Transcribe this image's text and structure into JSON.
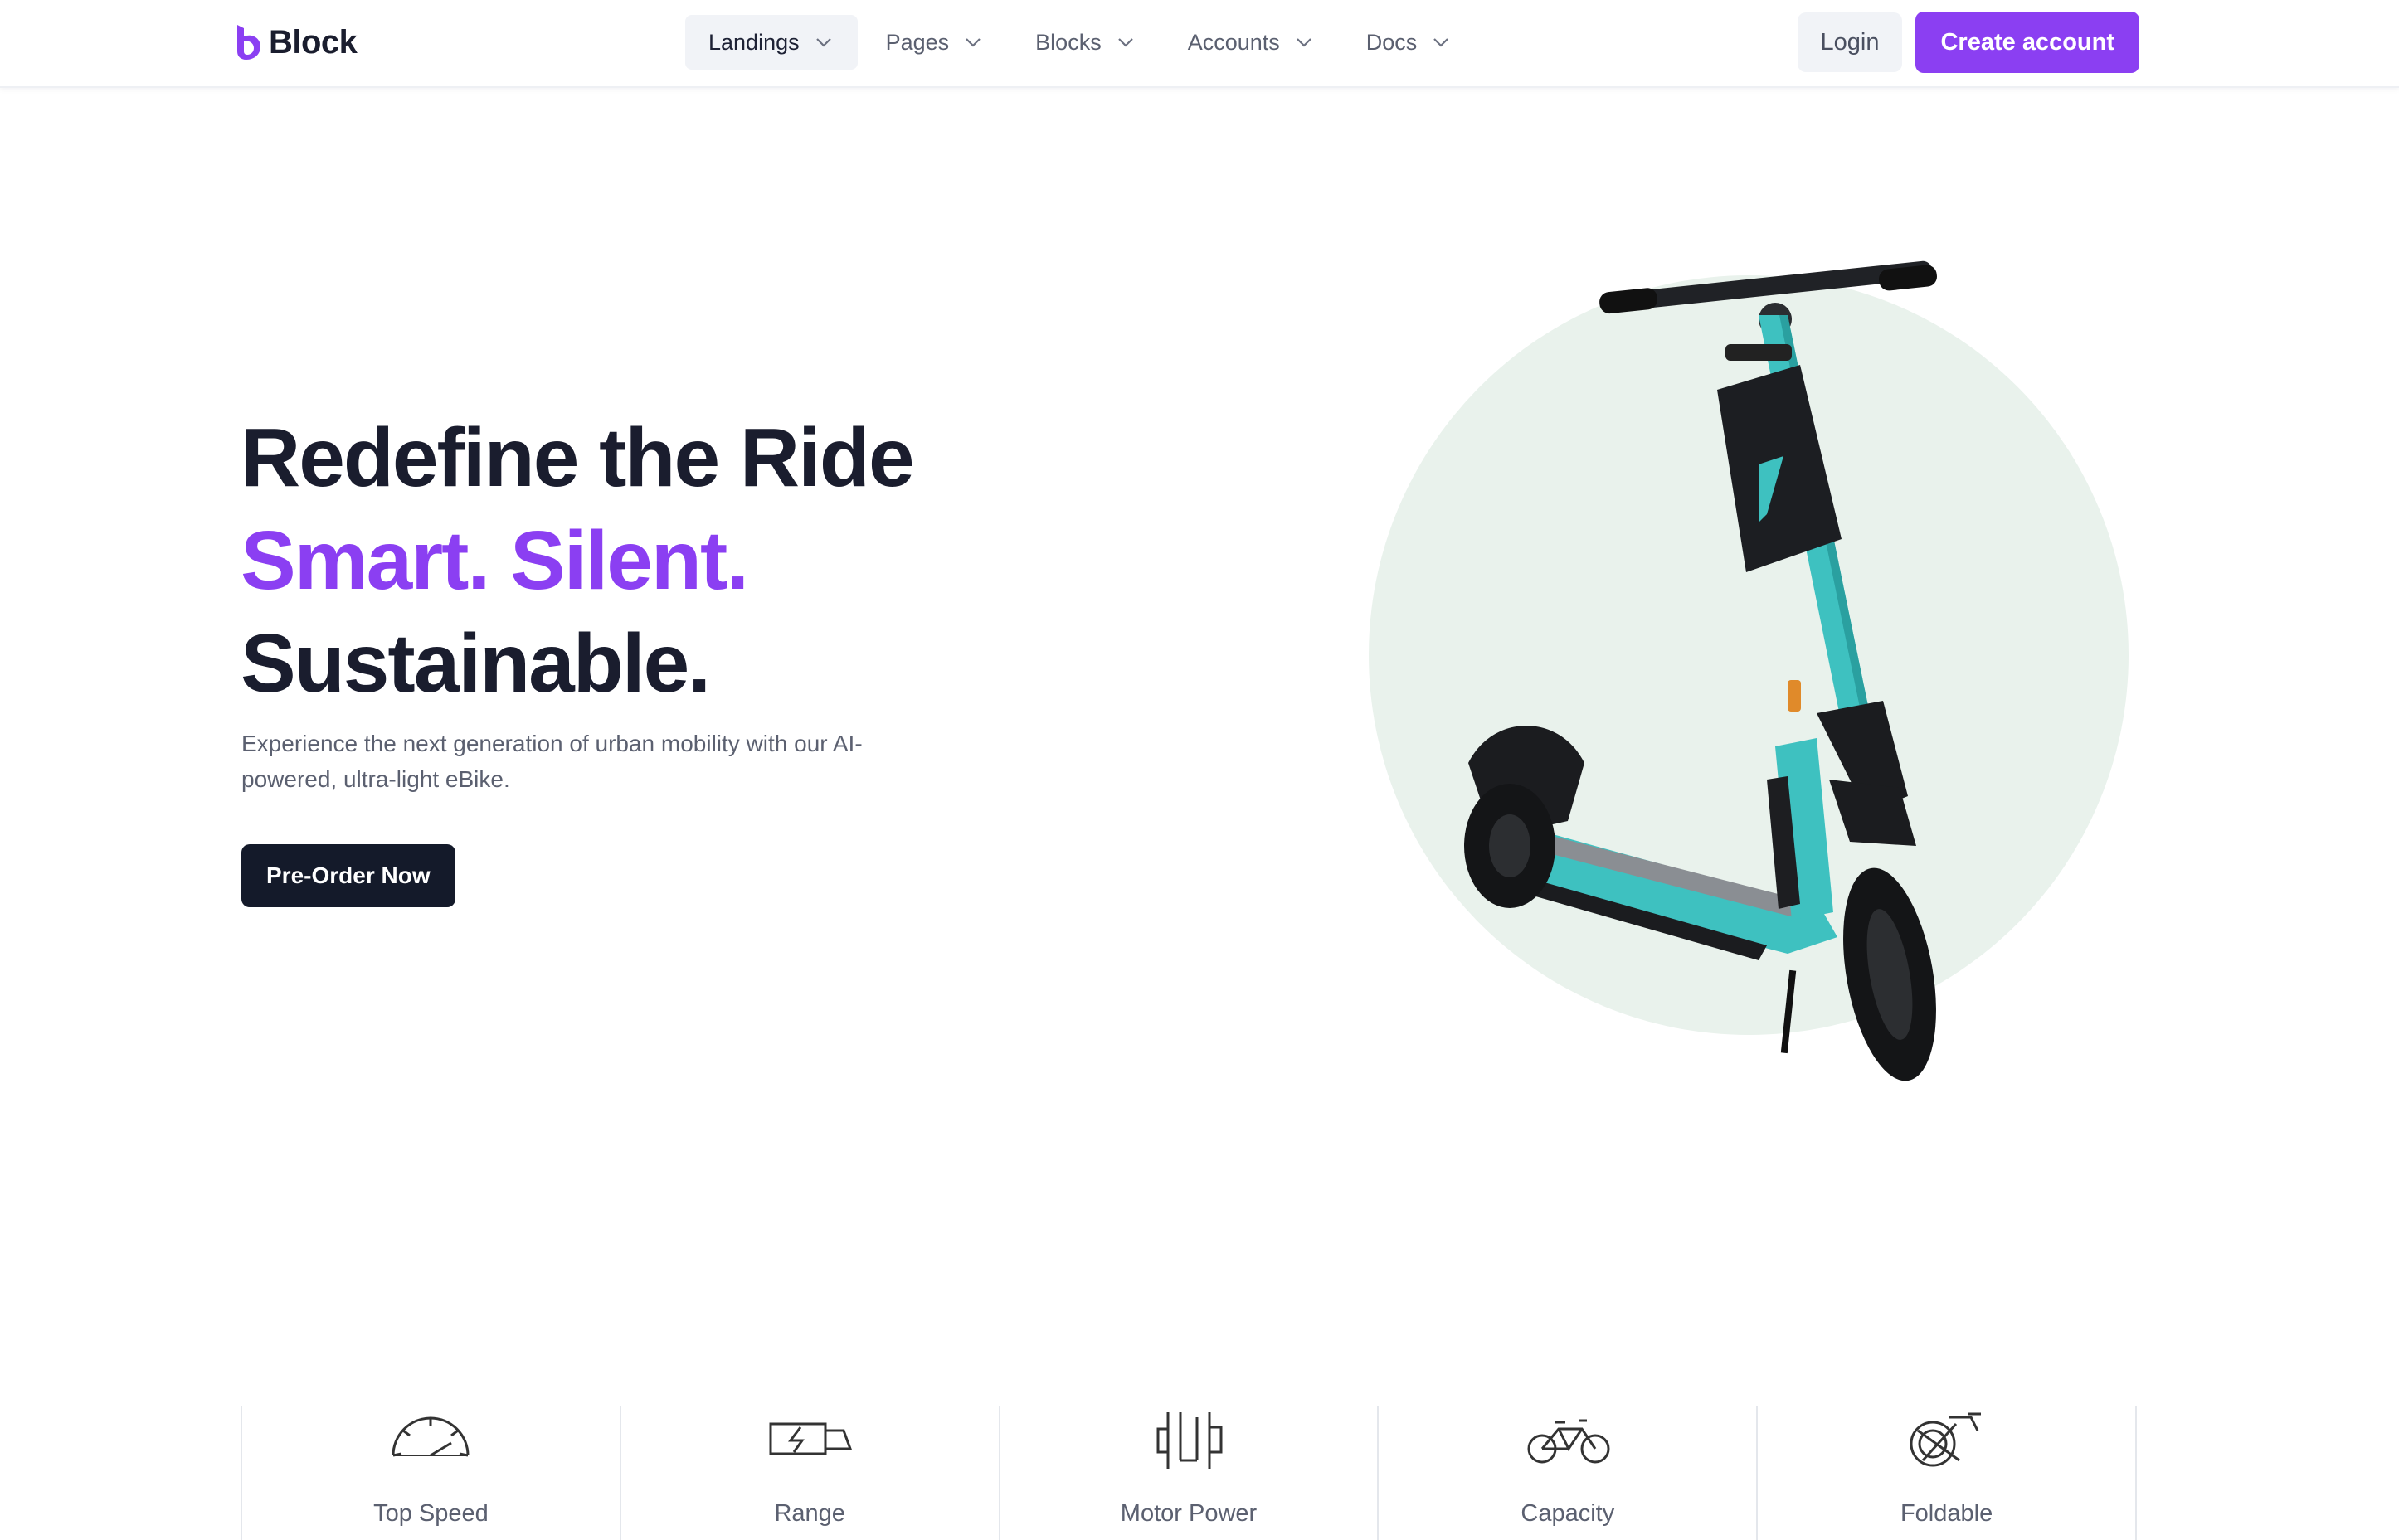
{
  "brand": {
    "name": "Block",
    "accent": "#8b3ff2"
  },
  "nav": {
    "items": [
      {
        "label": "Landings",
        "active": true
      },
      {
        "label": "Pages",
        "active": false
      },
      {
        "label": "Blocks",
        "active": false
      },
      {
        "label": "Accounts",
        "active": false
      },
      {
        "label": "Docs",
        "active": false
      }
    ]
  },
  "auth": {
    "login_label": "Login",
    "create_label": "Create account"
  },
  "hero": {
    "line1": "Redefine the Ride",
    "line2": "Smart. Silent.",
    "line3": "Sustainable.",
    "subtitle": "Experience the next generation of urban mobility with our AI-powered, ultra-light eBike.",
    "cta_label": "Pre-Order Now",
    "image": "electric-kick-scooter",
    "circle_color": "#e9f2ec",
    "scooter_color": "#3ec1c0"
  },
  "features": [
    {
      "label": "Top Speed",
      "icon": "speedometer-icon"
    },
    {
      "label": "Range",
      "icon": "battery-charging-icon"
    },
    {
      "label": "Motor Power",
      "icon": "motor-icon"
    },
    {
      "label": "Capacity",
      "icon": "bicycle-icon"
    },
    {
      "label": "Foldable",
      "icon": "foldable-bike-icon"
    }
  ]
}
